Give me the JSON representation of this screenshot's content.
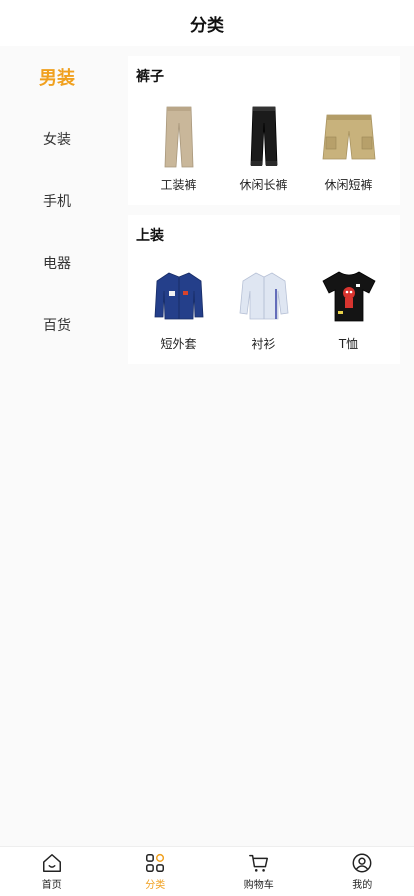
{
  "header": {
    "title": "分类"
  },
  "sidebar": {
    "items": [
      {
        "label": "男装"
      },
      {
        "label": "女装"
      },
      {
        "label": "手机"
      },
      {
        "label": "电器"
      },
      {
        "label": "百货"
      }
    ],
    "active_index": 0
  },
  "sections": [
    {
      "title": "裤子",
      "items": [
        {
          "label": "工装裤",
          "icon": "khaki-pants-image"
        },
        {
          "label": "休闲长裤",
          "icon": "black-pants-image"
        },
        {
          "label": "休闲短裤",
          "icon": "cargo-shorts-image"
        }
      ]
    },
    {
      "title": "上装",
      "items": [
        {
          "label": "短外套",
          "icon": "denim-jacket-image"
        },
        {
          "label": "衬衫",
          "icon": "shirt-image"
        },
        {
          "label": "T恤",
          "icon": "tshirt-image"
        }
      ]
    }
  ],
  "tabbar": {
    "items": [
      {
        "label": "首页",
        "icon": "home-icon"
      },
      {
        "label": "分类",
        "icon": "category-icon"
      },
      {
        "label": "购物车",
        "icon": "cart-icon"
      },
      {
        "label": "我的",
        "icon": "user-icon"
      }
    ],
    "active_index": 1
  },
  "colors": {
    "accent": "#f0a01e",
    "background": "#fafafa"
  }
}
